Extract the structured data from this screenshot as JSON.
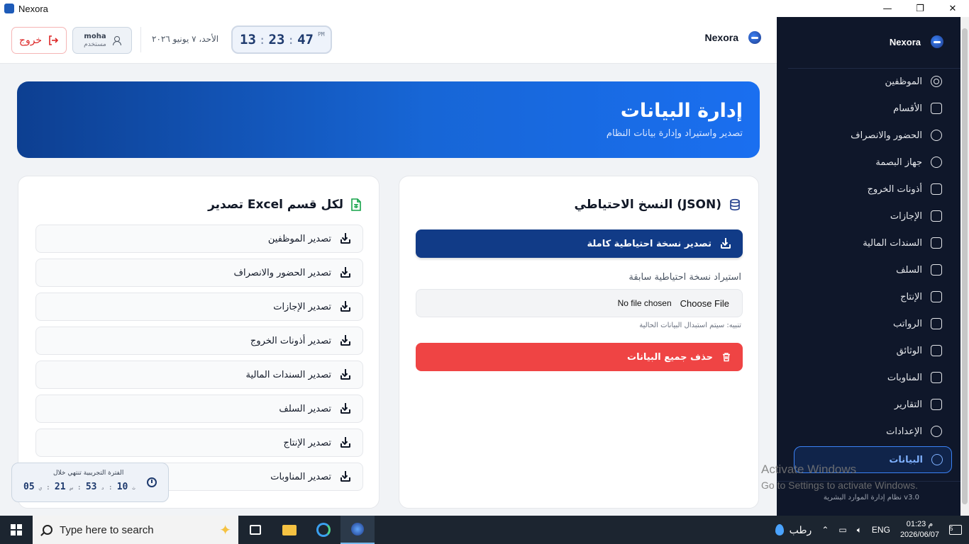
{
  "window": {
    "title": "Nexora",
    "controls": [
      "—",
      "❐",
      "✕"
    ]
  },
  "header": {
    "brand": "Nexora",
    "clock": {
      "hours": "13",
      "minutes": "23",
      "seconds": "47",
      "ampm": "PM"
    },
    "date": "الأحد، ٧ يونيو ٢٠٢٦",
    "user": {
      "name": "moha",
      "role": "مستخدم"
    },
    "logout_label": "خروج"
  },
  "banner": {
    "title": "إدارة البيانات",
    "subtitle": "تصدير واستيراد وإدارة بيانات النظام"
  },
  "backup": {
    "title": "النسخ الاحتياطي (JSON)",
    "export_label": "تصدير نسخة احتياطية كاملة",
    "import_label": "استيراد نسخة احتياطية سابقة",
    "choose_file": "Choose File",
    "no_file": "No file chosen",
    "warning": "تنبيه: سيتم استبدال البيانات الحالية",
    "delete_label": "حذف جميع البيانات"
  },
  "excel": {
    "title": "تصدير Excel لكل قسم",
    "items": [
      "تصدير الموظفين",
      "تصدير الحضور والانصراف",
      "تصدير الإجازات",
      "تصدير أذونات الخروج",
      "تصدير السندات المالية",
      "تصدير السلف",
      "تصدير الإنتاج",
      "تصدير المناوبات"
    ]
  },
  "trial": {
    "label": "الفترة التجريبية تنتهي خلال",
    "days": "05",
    "days_unit": "ي",
    "hours": "21",
    "hours_unit": "س",
    "minutes": "53",
    "minutes_unit": "د",
    "seconds": "10",
    "seconds_unit": "ث"
  },
  "sidebar": {
    "brand": "Nexora",
    "items": [
      {
        "label": "الموظفين",
        "icon": "users-icon"
      },
      {
        "label": "الأقسام",
        "icon": "building-icon"
      },
      {
        "label": "الحضور والانصراف",
        "icon": "clock-icon"
      },
      {
        "label": "جهاز البصمة",
        "icon": "fingerprint-icon"
      },
      {
        "label": "أذونات الخروج",
        "icon": "door-icon"
      },
      {
        "label": "الإجازات",
        "icon": "calendar-icon"
      },
      {
        "label": "السندات المالية",
        "icon": "dollar-icon"
      },
      {
        "label": "السلف",
        "icon": "credit-card-icon"
      },
      {
        "label": "الإنتاج",
        "icon": "chart-line-icon"
      },
      {
        "label": "الرواتب",
        "icon": "wallet-icon"
      },
      {
        "label": "الوثائق",
        "icon": "document-icon"
      },
      {
        "label": "المناوبات",
        "icon": "calendar-clock-icon"
      },
      {
        "label": "التقارير",
        "icon": "bar-chart-icon"
      },
      {
        "label": "الإعدادات",
        "icon": "gear-icon"
      },
      {
        "label": "البيانات",
        "icon": "database-icon",
        "active": true
      }
    ],
    "footer": "نظام إدارة الموارد البشرية v3.0"
  },
  "activate": {
    "line1": "Activate Windows",
    "line2": "Go to Settings to activate Windows."
  },
  "taskbar": {
    "search_placeholder": "Type here to search",
    "weather": "رطب",
    "lang": "ENG",
    "time": "01:23 م",
    "date": "2026/06/07",
    "notifications": "5"
  }
}
